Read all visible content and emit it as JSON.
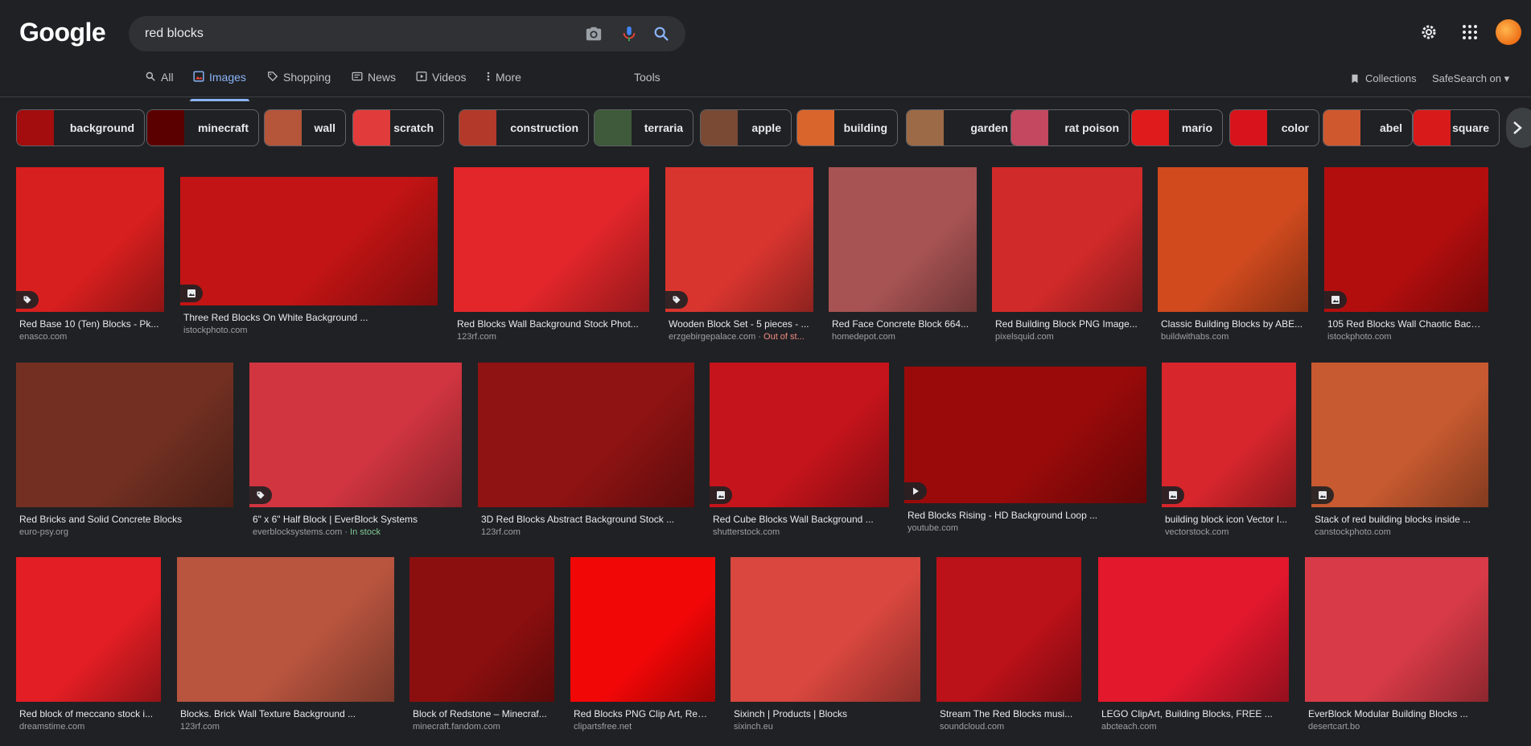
{
  "logo": "Google",
  "search": {
    "value": "red blocks"
  },
  "nav": {
    "tabs": [
      {
        "label": "All",
        "icon": "search-icon"
      },
      {
        "label": "Images",
        "icon": "image-icon",
        "active": true
      },
      {
        "label": "Shopping",
        "icon": "tag-icon"
      },
      {
        "label": "News",
        "icon": "news-icon"
      },
      {
        "label": "Videos",
        "icon": "video-icon"
      },
      {
        "label": "More",
        "icon": "more-vert-icon"
      }
    ],
    "tools": "Tools",
    "collections": "Collections",
    "safesearch": "SafeSearch on"
  },
  "chips": [
    {
      "label": "background",
      "color": "#a30d0d"
    },
    {
      "label": "minecraft",
      "color": "#5a0000"
    },
    {
      "label": "wall",
      "color": "#b5553a"
    },
    {
      "label": "scratch",
      "color": "#e23b3b"
    },
    {
      "label": "construction",
      "color": "#b33a2a"
    },
    {
      "label": "terraria",
      "color": "#3e5a3a"
    },
    {
      "label": "apple",
      "color": "#7a4a34"
    },
    {
      "label": "building",
      "color": "#d9652c"
    },
    {
      "label": "garden",
      "color": "#9c6a46"
    },
    {
      "label": "rat poison",
      "color": "#c44860"
    },
    {
      "label": "mario",
      "color": "#e01b1b"
    },
    {
      "label": "color",
      "color": "#d8131b"
    },
    {
      "label": "abel",
      "color": "#d0582e"
    },
    {
      "label": "square",
      "color": "#d81a1a"
    }
  ],
  "results": [
    {
      "title": "Red Base 10 (Ten) Blocks - Pk...",
      "source": "enasco.com",
      "badge": "tag-icon",
      "color": "#d81f1f"
    },
    {
      "title": "Three Red Blocks On White Background ...",
      "source": "istockphoto.com",
      "badge": "image-icon",
      "color": "#c21414"
    },
    {
      "title": "Red Blocks Wall Background Stock Phot...",
      "source": "123rf.com",
      "badge": "",
      "color": "#e3262a"
    },
    {
      "title": "Wooden Block Set - 5 pieces - ...",
      "source": "erzgebirgepalace.com",
      "stock": "Out of st...",
      "badge": "tag-icon",
      "color": "#d9352f"
    },
    {
      "title": "Red Face Concrete Block 664...",
      "source": "homedepot.com",
      "badge": "",
      "color": "#a85353"
    },
    {
      "title": "Red Building Block PNG Image...",
      "source": "pixelsquid.com",
      "badge": "",
      "color": "#d12a2a"
    },
    {
      "title": "Classic Building Blocks by ABE...",
      "source": "buildwithabs.com",
      "badge": "",
      "color": "#d04a1e"
    },
    {
      "title": "105 Red Blocks Wall Chaotic Background...",
      "source": "istockphoto.com",
      "badge": "image-icon",
      "color": "#b30e0e"
    },
    {
      "title": "Red Bricks and Solid Concrete Blocks",
      "source": "euro-psy.org",
      "badge": "",
      "color": "#733022"
    },
    {
      "title": "6\" x 6\" Half Block | EverBlock Systems",
      "source": "everblocksystems.com",
      "stock": "In stock",
      "badge": "tag-icon",
      "color": "#d13540"
    },
    {
      "title": "3D Red Blocks Abstract Background Stock ...",
      "source": "123rf.com",
      "badge": "",
      "color": "#8f1313"
    },
    {
      "title": "Red Cube Blocks Wall Background ...",
      "source": "shutterstock.com",
      "badge": "image-icon",
      "color": "#c5141b"
    },
    {
      "title": "Red Blocks Rising - HD Background Loop ...",
      "source": "youtube.com",
      "badge": "play-icon",
      "color": "#9a0a0a"
    },
    {
      "title": "building block icon Vector I...",
      "source": "vectorstock.com",
      "badge": "image-icon",
      "color": "#d7262c"
    },
    {
      "title": "Stack of red building blocks inside ...",
      "source": "canstockphoto.com",
      "badge": "image-icon",
      "color": "#c75a30"
    },
    {
      "title": "Red block of meccano stock i...",
      "source": "dreamstime.com",
      "badge": "",
      "color": "#e31e24"
    },
    {
      "title": "Blocks. Brick Wall Texture Background ...",
      "source": "123rf.com",
      "badge": "",
      "color": "#b9553f"
    },
    {
      "title": "Block of Redstone – Minecraf...",
      "source": "minecraft.fandom.com",
      "badge": "",
      "color": "#8c0f0f"
    },
    {
      "title": "Red Blocks PNG Clip Art, Red ...",
      "source": "clipartsfree.net",
      "badge": "",
      "color": "#f20707"
    },
    {
      "title": "Sixinch | Products | Blocks",
      "source": "sixinch.eu",
      "badge": "",
      "color": "#d9473f"
    },
    {
      "title": "Stream The Red Blocks musi...",
      "source": "soundcloud.com",
      "badge": "",
      "color": "#bb1119"
    },
    {
      "title": "LEGO ClipArt, Building Blocks, FREE ...",
      "source": "abcteach.com",
      "badge": "",
      "color": "#e3182d"
    },
    {
      "title": "EverBlock Modular Building Blocks ...",
      "source": "desertcart.bo",
      "badge": "",
      "color": "#d83b47"
    }
  ]
}
